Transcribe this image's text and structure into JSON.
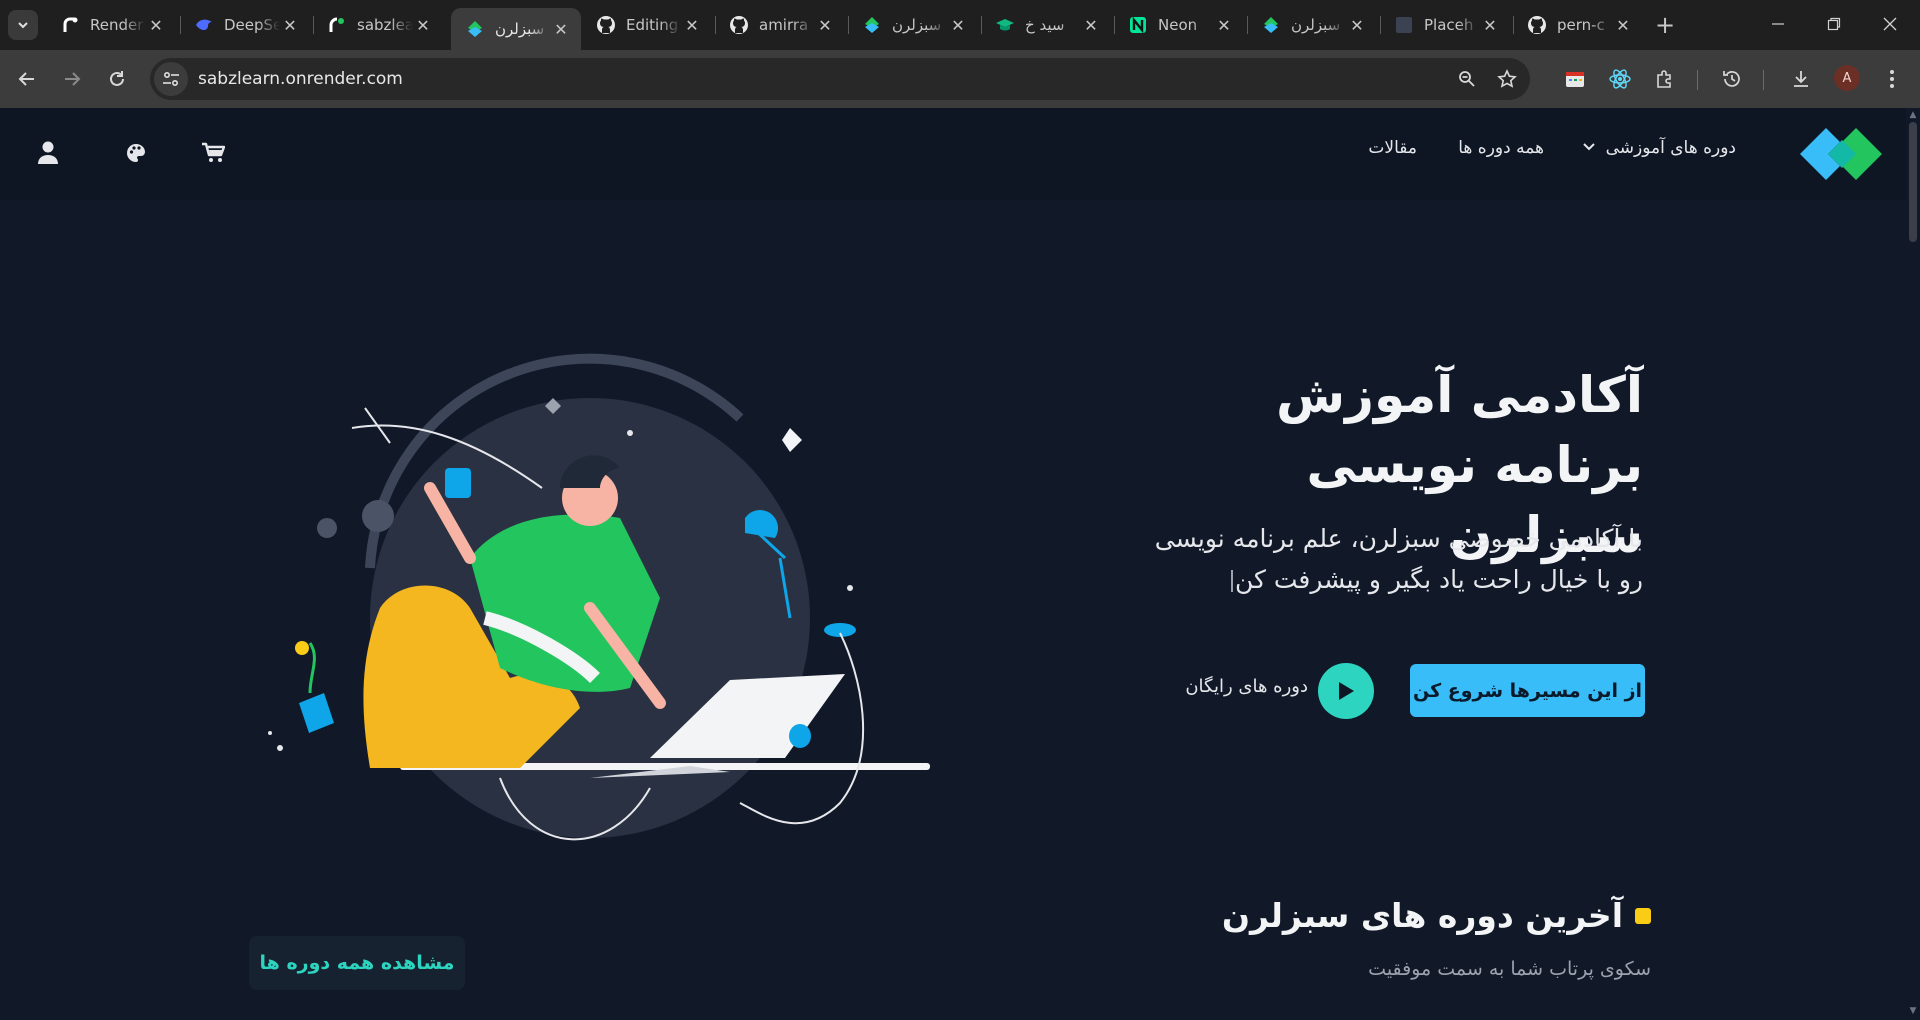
{
  "browser": {
    "tabs": [
      {
        "title": "Render",
        "icon": "render-favicon"
      },
      {
        "title": "DeepSeek",
        "icon": "deepseek-favicon"
      },
      {
        "title": "sabzlearn",
        "icon": "sabzlearn-favicon"
      },
      {
        "title": "سبزلرن",
        "icon": "sabzlearn-logo-favicon",
        "active": true
      },
      {
        "title": "Editing",
        "icon": "github-favicon"
      },
      {
        "title": "amirra",
        "icon": "github-favicon"
      },
      {
        "title": "سبزلرن",
        "icon": "sabzlearn-logo-favicon"
      },
      {
        "title": "سید خ",
        "icon": "graduation-cap-favicon"
      },
      {
        "title": "Neon",
        "icon": "neon-favicon"
      },
      {
        "title": "سبزلرن",
        "icon": "sabzlearn-logo-favicon"
      },
      {
        "title": "Placeh",
        "icon": "placeholder-favicon"
      },
      {
        "title": "pern-c",
        "icon": "github-favicon"
      }
    ],
    "url": "sabzlearn.onrender.com",
    "profile_initial": "A"
  },
  "header": {
    "nav": {
      "courses": "دوره های آموزشی",
      "all_courses": "همه دوره ها",
      "articles": "مقالات"
    }
  },
  "hero": {
    "title_line1": "آکادمی آموزش",
    "title_line2": "برنامه نویسی سبزلرن",
    "subtitle": "با آکادمی خصوصی سبزلرن، علم برنامه نویسی رو با خیال راحت یاد بگیر و پیشرفت کن",
    "cta": "از این مسیرها شروع کن",
    "free_courses": "دوره های رایگان"
  },
  "latest": {
    "title": "آخرین دوره های سبزلرن",
    "subtitle": "سکوی پرتاب شما به سمت موفقیت",
    "view_all": "مشاهده همه دوره ها"
  },
  "colors": {
    "background": "#111827",
    "header": "#0f1623",
    "accent_blue": "#38bdf8",
    "accent_teal": "#2dd4bf",
    "accent_yellow": "#facc15"
  }
}
